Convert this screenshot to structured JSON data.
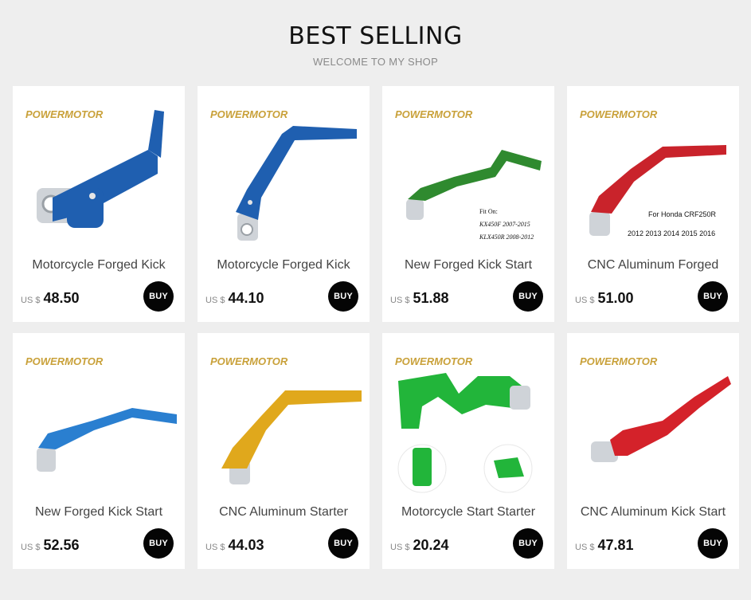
{
  "header": {
    "title": "BEST SELLING",
    "subtitle": "WELCOME TO MY SHOP"
  },
  "buy_label": "BUY",
  "brand_logo_text": "POWERMOTOR",
  "products": [
    {
      "title": "Motorcycle Forged Kick",
      "currency": "US $",
      "price": "48.50",
      "color": "#1f5fb0",
      "image_text": []
    },
    {
      "title": "Motorcycle Forged Kick",
      "currency": "US $",
      "price": "44.10",
      "color": "#1f5fb0",
      "image_text": []
    },
    {
      "title": "New Forged Kick Start",
      "currency": "US $",
      "price": "51.88",
      "color": "#2f8a2f",
      "image_text": [
        "Fit On:",
        "KX450F 2007-2015",
        "KLX450R 2008-2012"
      ]
    },
    {
      "title": "CNC Aluminum Forged",
      "currency": "US $",
      "price": "51.00",
      "color": "#c9232b",
      "image_text": [
        "For Honda CRF250R",
        "2012 2013 2014 2015 2016"
      ]
    },
    {
      "title": "New Forged Kick Start",
      "currency": "US $",
      "price": "52.56",
      "color": "#2a7fd0",
      "image_text": []
    },
    {
      "title": "CNC Aluminum Starter",
      "currency": "US $",
      "price": "44.03",
      "color": "#e0a81c",
      "image_text": []
    },
    {
      "title": "Motorcycle Start Starter",
      "currency": "US $",
      "price": "20.24",
      "color": "#22b53a",
      "image_text": []
    },
    {
      "title": "CNC Aluminum Kick Start",
      "currency": "US $",
      "price": "47.81",
      "color": "#d4222a",
      "image_text": []
    }
  ]
}
